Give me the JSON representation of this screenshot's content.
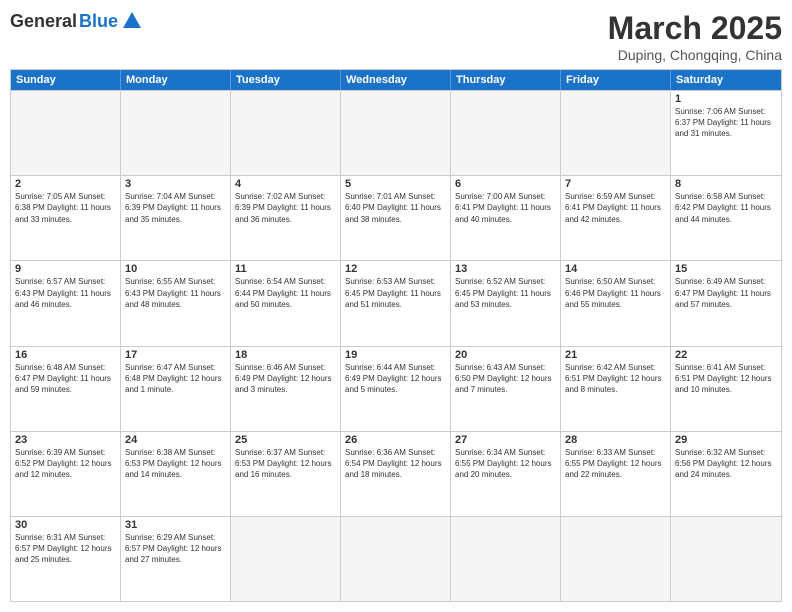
{
  "header": {
    "logo_general": "General",
    "logo_blue": "Blue",
    "month_title": "March 2025",
    "subtitle": "Duping, Chongqing, China"
  },
  "days_of_week": [
    "Sunday",
    "Monday",
    "Tuesday",
    "Wednesday",
    "Thursday",
    "Friday",
    "Saturday"
  ],
  "rows": [
    [
      {
        "day": "",
        "info": ""
      },
      {
        "day": "",
        "info": ""
      },
      {
        "day": "",
        "info": ""
      },
      {
        "day": "",
        "info": ""
      },
      {
        "day": "",
        "info": ""
      },
      {
        "day": "",
        "info": ""
      },
      {
        "day": "1",
        "info": "Sunrise: 7:06 AM\nSunset: 6:37 PM\nDaylight: 11 hours and 31 minutes."
      }
    ],
    [
      {
        "day": "2",
        "info": "Sunrise: 7:05 AM\nSunset: 6:38 PM\nDaylight: 11 hours and 33 minutes."
      },
      {
        "day": "3",
        "info": "Sunrise: 7:04 AM\nSunset: 6:39 PM\nDaylight: 11 hours and 35 minutes."
      },
      {
        "day": "4",
        "info": "Sunrise: 7:02 AM\nSunset: 6:39 PM\nDaylight: 11 hours and 36 minutes."
      },
      {
        "day": "5",
        "info": "Sunrise: 7:01 AM\nSunset: 6:40 PM\nDaylight: 11 hours and 38 minutes."
      },
      {
        "day": "6",
        "info": "Sunrise: 7:00 AM\nSunset: 6:41 PM\nDaylight: 11 hours and 40 minutes."
      },
      {
        "day": "7",
        "info": "Sunrise: 6:59 AM\nSunset: 6:41 PM\nDaylight: 11 hours and 42 minutes."
      },
      {
        "day": "8",
        "info": "Sunrise: 6:58 AM\nSunset: 6:42 PM\nDaylight: 11 hours and 44 minutes."
      }
    ],
    [
      {
        "day": "9",
        "info": "Sunrise: 6:57 AM\nSunset: 6:43 PM\nDaylight: 11 hours and 46 minutes."
      },
      {
        "day": "10",
        "info": "Sunrise: 6:55 AM\nSunset: 6:43 PM\nDaylight: 11 hours and 48 minutes."
      },
      {
        "day": "11",
        "info": "Sunrise: 6:54 AM\nSunset: 6:44 PM\nDaylight: 11 hours and 50 minutes."
      },
      {
        "day": "12",
        "info": "Sunrise: 6:53 AM\nSunset: 6:45 PM\nDaylight: 11 hours and 51 minutes."
      },
      {
        "day": "13",
        "info": "Sunrise: 6:52 AM\nSunset: 6:45 PM\nDaylight: 11 hours and 53 minutes."
      },
      {
        "day": "14",
        "info": "Sunrise: 6:50 AM\nSunset: 6:46 PM\nDaylight: 11 hours and 55 minutes."
      },
      {
        "day": "15",
        "info": "Sunrise: 6:49 AM\nSunset: 6:47 PM\nDaylight: 11 hours and 57 minutes."
      }
    ],
    [
      {
        "day": "16",
        "info": "Sunrise: 6:48 AM\nSunset: 6:47 PM\nDaylight: 11 hours and 59 minutes."
      },
      {
        "day": "17",
        "info": "Sunrise: 6:47 AM\nSunset: 6:48 PM\nDaylight: 12 hours and 1 minute."
      },
      {
        "day": "18",
        "info": "Sunrise: 6:46 AM\nSunset: 6:49 PM\nDaylight: 12 hours and 3 minutes."
      },
      {
        "day": "19",
        "info": "Sunrise: 6:44 AM\nSunset: 6:49 PM\nDaylight: 12 hours and 5 minutes."
      },
      {
        "day": "20",
        "info": "Sunrise: 6:43 AM\nSunset: 6:50 PM\nDaylight: 12 hours and 7 minutes."
      },
      {
        "day": "21",
        "info": "Sunrise: 6:42 AM\nSunset: 6:51 PM\nDaylight: 12 hours and 8 minutes."
      },
      {
        "day": "22",
        "info": "Sunrise: 6:41 AM\nSunset: 6:51 PM\nDaylight: 12 hours and 10 minutes."
      }
    ],
    [
      {
        "day": "23",
        "info": "Sunrise: 6:39 AM\nSunset: 6:52 PM\nDaylight: 12 hours and 12 minutes."
      },
      {
        "day": "24",
        "info": "Sunrise: 6:38 AM\nSunset: 6:53 PM\nDaylight: 12 hours and 14 minutes."
      },
      {
        "day": "25",
        "info": "Sunrise: 6:37 AM\nSunset: 6:53 PM\nDaylight: 12 hours and 16 minutes."
      },
      {
        "day": "26",
        "info": "Sunrise: 6:36 AM\nSunset: 6:54 PM\nDaylight: 12 hours and 18 minutes."
      },
      {
        "day": "27",
        "info": "Sunrise: 6:34 AM\nSunset: 6:55 PM\nDaylight: 12 hours and 20 minutes."
      },
      {
        "day": "28",
        "info": "Sunrise: 6:33 AM\nSunset: 6:55 PM\nDaylight: 12 hours and 22 minutes."
      },
      {
        "day": "29",
        "info": "Sunrise: 6:32 AM\nSunset: 6:56 PM\nDaylight: 12 hours and 24 minutes."
      }
    ],
    [
      {
        "day": "30",
        "info": "Sunrise: 6:31 AM\nSunset: 6:57 PM\nDaylight: 12 hours and 25 minutes."
      },
      {
        "day": "31",
        "info": "Sunrise: 6:29 AM\nSunset: 6:57 PM\nDaylight: 12 hours and 27 minutes."
      },
      {
        "day": "",
        "info": ""
      },
      {
        "day": "",
        "info": ""
      },
      {
        "day": "",
        "info": ""
      },
      {
        "day": "",
        "info": ""
      },
      {
        "day": "",
        "info": ""
      }
    ]
  ]
}
